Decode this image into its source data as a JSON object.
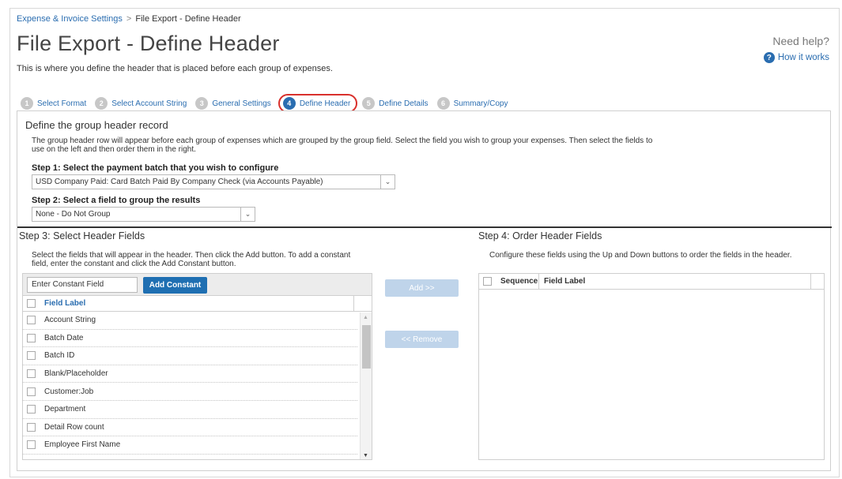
{
  "breadcrumb": {
    "parent": "Expense & Invoice Settings",
    "separator": ">",
    "current": "File Export - Define Header"
  },
  "page": {
    "title": "File Export - Define Header",
    "description": "This is where you define the header that is placed before each group of expenses."
  },
  "help": {
    "need_help": "Need help?",
    "how_it_works": "How it works",
    "icon": "question-circle-icon"
  },
  "wizard": {
    "steps": [
      {
        "num": "1",
        "label": "Select Format"
      },
      {
        "num": "2",
        "label": "Select Account String"
      },
      {
        "num": "3",
        "label": "General Settings"
      },
      {
        "num": "4",
        "label": "Define Header",
        "active": true
      },
      {
        "num": "5",
        "label": "Define Details"
      },
      {
        "num": "6",
        "label": "Summary/Copy"
      }
    ],
    "active_color": "#2a6db0",
    "highlight_color": "#d9302c"
  },
  "group": {
    "title": "Define the group header record",
    "description": "The group header row will appear before each group of expenses which are grouped by the group field. Select the field you wish to group your expenses. Then select the fields to use on the left and then order them in the right.",
    "step1_label": "Step 1: Select the payment batch that you wish to configure",
    "step1_value": "USD Company Paid: Card Batch Paid By Company Check (via Accounts Payable)",
    "step2_label": "Step 2: Select a field to group the results",
    "step2_value": "None - Do Not Group"
  },
  "step3": {
    "title": "Step 3: Select Header Fields",
    "description": "Select the fields that will appear in the header. Then click the Add button. To add a constant field, enter the constant and click the Add Constant button.",
    "constant_placeholder": "Enter Constant Field",
    "add_constant_label": "Add Constant",
    "column_header": "Field Label",
    "rows": [
      "Account String",
      "Batch Date",
      "Batch ID",
      "Blank/Placeholder",
      "Customer:Job",
      "Department",
      "Detail Row count",
      "Employee First Name"
    ]
  },
  "buttons": {
    "add": "Add >>",
    "remove": "<< Remove"
  },
  "step4": {
    "title": "Step 4: Order Header Fields",
    "description": "Configure these fields using the Up and Down buttons to order the fields in the header.",
    "col_sequence": "Sequence",
    "col_field_label": "Field Label"
  }
}
